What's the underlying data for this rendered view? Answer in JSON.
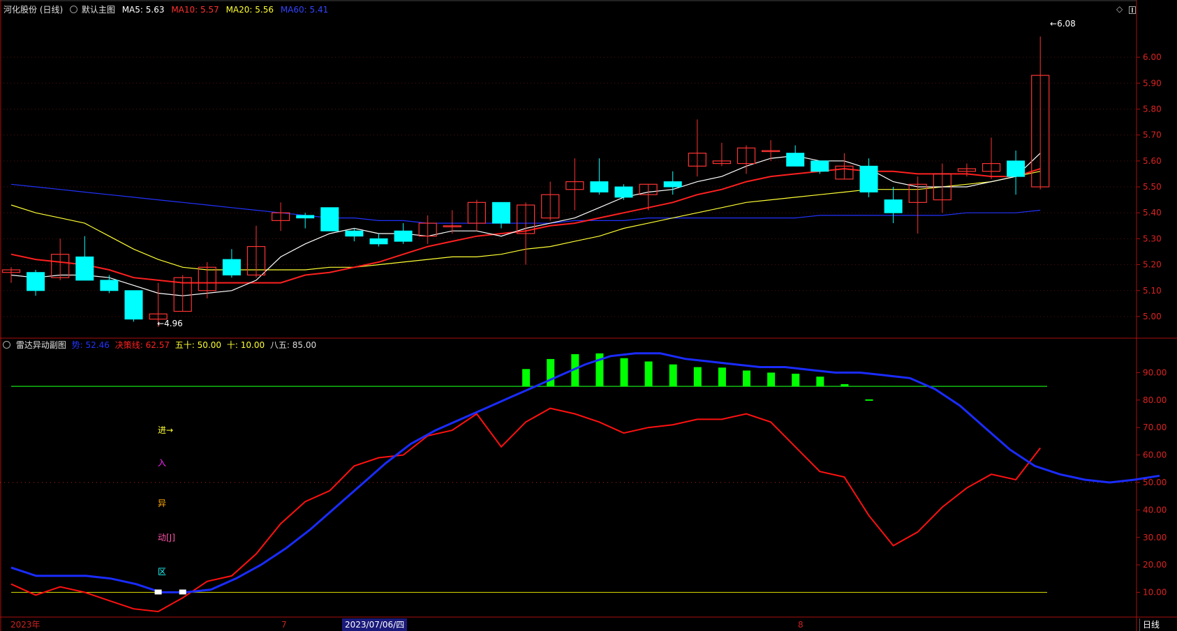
{
  "colors": {
    "background": "#000000",
    "up": "#ff3333",
    "down": "#00ffff",
    "ma5": "#ffffff",
    "ma10": "#ff2020",
    "ma20": "#ffff33",
    "ma60": "#2233ff",
    "axis": "#aa1111",
    "line_blue": "#1a2cff",
    "line_red": "#ff1111",
    "bars": "#00ff00",
    "level85": "#11bb11",
    "level10": "#cccc00"
  },
  "main_header": {
    "stock": "河化股份 (日线)",
    "template_icon": "circle-icon",
    "template": "默认主图",
    "ma5": {
      "label": "MA5:",
      "value": "5.63"
    },
    "ma10": {
      "label": "MA10:",
      "value": "5.57"
    },
    "ma20": {
      "label": "MA20:",
      "value": "5.56"
    },
    "ma60": {
      "label": "MA60:",
      "value": "5.41"
    }
  },
  "sub_header": {
    "name": "雷达异动副图",
    "v1": {
      "label": "势:",
      "value": "52.46"
    },
    "v2": {
      "label": "决策线:",
      "value": "62.57"
    },
    "v3": {
      "label": "五十:",
      "value": "50.00"
    },
    "v4": {
      "label": "十:",
      "value": "10.00"
    },
    "v5": {
      "label": "八五:",
      "value": "85.00"
    }
  },
  "annotations": {
    "high": "6.08",
    "low": "4.96",
    "signal": [
      "进→",
      "入",
      "异",
      "动[J]",
      "区"
    ]
  },
  "bottom": {
    "start": "2023年",
    "m7": "7",
    "selected_date": "2023/07/06/四",
    "m8": "8",
    "period_tab": "日线"
  },
  "chart_data": [
    {
      "type": "candlestick",
      "title": "河化股份 (日线)",
      "y_ticks": [
        "6.00",
        "5.90",
        "5.80",
        "5.70",
        "5.60",
        "5.50",
        "5.40",
        "5.30",
        "5.20",
        "5.10",
        "5.00"
      ],
      "ylim": [
        4.93,
        6.14
      ],
      "ohlc": [
        [
          5.17,
          5.19,
          5.13,
          5.18
        ],
        [
          5.17,
          5.18,
          5.08,
          5.1
        ],
        [
          5.15,
          5.3,
          5.14,
          5.24
        ],
        [
          5.23,
          5.31,
          5.14,
          5.14
        ],
        [
          5.14,
          5.16,
          5.09,
          5.1
        ],
        [
          5.1,
          5.1,
          4.98,
          4.99
        ],
        [
          4.99,
          5.13,
          4.96,
          5.01
        ],
        [
          5.02,
          5.16,
          5.02,
          5.15
        ],
        [
          5.1,
          5.21,
          5.07,
          5.19
        ],
        [
          5.22,
          5.26,
          5.15,
          5.16
        ],
        [
          5.16,
          5.35,
          5.15,
          5.27
        ],
        [
          5.37,
          5.44,
          5.33,
          5.4
        ],
        [
          5.39,
          5.4,
          5.34,
          5.38
        ],
        [
          5.42,
          5.42,
          5.33,
          5.33
        ],
        [
          5.33,
          5.34,
          5.29,
          5.31
        ],
        [
          5.3,
          5.32,
          5.27,
          5.28
        ],
        [
          5.33,
          5.36,
          5.28,
          5.29
        ],
        [
          5.31,
          5.39,
          5.28,
          5.36
        ],
        [
          5.35,
          5.41,
          5.32,
          5.35
        ],
        [
          5.36,
          5.45,
          5.33,
          5.44
        ],
        [
          5.44,
          5.44,
          5.34,
          5.36
        ],
        [
          5.32,
          5.44,
          5.2,
          5.43
        ],
        [
          5.38,
          5.52,
          5.37,
          5.47
        ],
        [
          5.49,
          5.61,
          5.41,
          5.52
        ],
        [
          5.52,
          5.61,
          5.47,
          5.48
        ],
        [
          5.5,
          5.51,
          5.45,
          5.46
        ],
        [
          5.47,
          5.51,
          5.41,
          5.51
        ],
        [
          5.52,
          5.56,
          5.47,
          5.5
        ],
        [
          5.58,
          5.76,
          5.54,
          5.63
        ],
        [
          5.59,
          5.67,
          5.58,
          5.6
        ],
        [
          5.59,
          5.66,
          5.55,
          5.65
        ],
        [
          5.64,
          5.68,
          5.6,
          5.64
        ],
        [
          5.63,
          5.66,
          5.58,
          5.58
        ],
        [
          5.6,
          5.6,
          5.55,
          5.56
        ],
        [
          5.53,
          5.63,
          5.53,
          5.58
        ],
        [
          5.58,
          5.61,
          5.46,
          5.48
        ],
        [
          5.45,
          5.5,
          5.36,
          5.4
        ],
        [
          5.44,
          5.54,
          5.32,
          5.51
        ],
        [
          5.45,
          5.59,
          5.4,
          5.55
        ],
        [
          5.56,
          5.59,
          5.54,
          5.57
        ],
        [
          5.56,
          5.69,
          5.53,
          5.59
        ],
        [
          5.6,
          5.64,
          5.47,
          5.54
        ],
        [
          5.5,
          6.08,
          5.49,
          5.93
        ]
      ],
      "ma5": [
        5.16,
        5.15,
        5.16,
        5.16,
        5.15,
        5.12,
        5.09,
        5.08,
        5.09,
        5.1,
        5.14,
        5.23,
        5.28,
        5.32,
        5.34,
        5.32,
        5.32,
        5.31,
        5.33,
        5.33,
        5.31,
        5.34,
        5.36,
        5.38,
        5.42,
        5.46,
        5.48,
        5.49,
        5.52,
        5.54,
        5.58,
        5.61,
        5.62,
        5.6,
        5.6,
        5.57,
        5.52,
        5.5,
        5.5,
        5.5,
        5.52,
        5.54,
        5.63
      ],
      "ma10": [
        5.24,
        5.22,
        5.21,
        5.2,
        5.18,
        5.15,
        5.14,
        5.13,
        5.13,
        5.13,
        5.13,
        5.13,
        5.16,
        5.17,
        5.19,
        5.21,
        5.24,
        5.27,
        5.29,
        5.31,
        5.32,
        5.33,
        5.35,
        5.36,
        5.38,
        5.4,
        5.42,
        5.44,
        5.47,
        5.49,
        5.52,
        5.54,
        5.55,
        5.56,
        5.57,
        5.56,
        5.56,
        5.55,
        5.55,
        5.55,
        5.54,
        5.54,
        5.57
      ],
      "ma20": [
        5.43,
        5.4,
        5.38,
        5.36,
        5.31,
        5.26,
        5.22,
        5.19,
        5.18,
        5.18,
        5.18,
        5.18,
        5.18,
        5.19,
        5.19,
        5.2,
        5.21,
        5.22,
        5.23,
        5.23,
        5.24,
        5.26,
        5.27,
        5.29,
        5.31,
        5.34,
        5.36,
        5.38,
        5.4,
        5.42,
        5.44,
        5.45,
        5.46,
        5.47,
        5.48,
        5.49,
        5.49,
        5.49,
        5.5,
        5.51,
        5.52,
        5.54,
        5.56
      ],
      "ma60": [
        5.51,
        5.5,
        5.49,
        5.48,
        5.47,
        5.46,
        5.45,
        5.44,
        5.43,
        5.42,
        5.41,
        5.4,
        5.39,
        5.38,
        5.38,
        5.37,
        5.37,
        5.36,
        5.36,
        5.36,
        5.36,
        5.36,
        5.36,
        5.37,
        5.37,
        5.37,
        5.38,
        5.38,
        5.38,
        5.38,
        5.38,
        5.38,
        5.38,
        5.39,
        5.39,
        5.39,
        5.39,
        5.39,
        5.39,
        5.4,
        5.4,
        5.4,
        5.41
      ]
    },
    {
      "type": "line",
      "title": "雷达异动副图",
      "y_ticks": [
        "90.00",
        "80.00",
        "70.00",
        "60.00",
        "50.00",
        "40.00",
        "30.00",
        "20.00",
        "10.00"
      ],
      "ylim": [
        1,
        100
      ],
      "levels": [
        85,
        50,
        10
      ],
      "series": [
        {
          "name": "势",
          "values": [
            19,
            16,
            16,
            16,
            15,
            13,
            10,
            10,
            11,
            15,
            20,
            26,
            33,
            41,
            49,
            57,
            64,
            69,
            73,
            77,
            81,
            85,
            89,
            93,
            96,
            97,
            97,
            95,
            94,
            93,
            92,
            92,
            91,
            90,
            90,
            89,
            88,
            84,
            78,
            70,
            62,
            56,
            53,
            51,
            50,
            51,
            52.46
          ]
        },
        {
          "name": "决策线",
          "values": [
            13,
            9,
            12,
            10,
            7,
            4,
            3,
            8,
            14,
            16,
            24,
            35,
            43,
            47,
            56,
            59,
            60,
            67,
            69,
            75,
            63,
            72,
            77,
            75,
            72,
            68,
            70,
            71,
            73,
            73,
            75,
            72,
            63,
            54,
            52,
            38,
            27,
            32,
            41,
            48,
            53,
            51,
            62.57
          ]
        }
      ],
      "bars_above_85": [
        0,
        0,
        0,
        0,
        0,
        0,
        0,
        0,
        0,
        0,
        0,
        0,
        0,
        0,
        0,
        0,
        0,
        0,
        0,
        0,
        0,
        1,
        1,
        1,
        1,
        1,
        1,
        1,
        1,
        1,
        1,
        1,
        1,
        1,
        1,
        1,
        0,
        0,
        0,
        0,
        0,
        0,
        0
      ],
      "markers": [
        6,
        7
      ]
    }
  ]
}
